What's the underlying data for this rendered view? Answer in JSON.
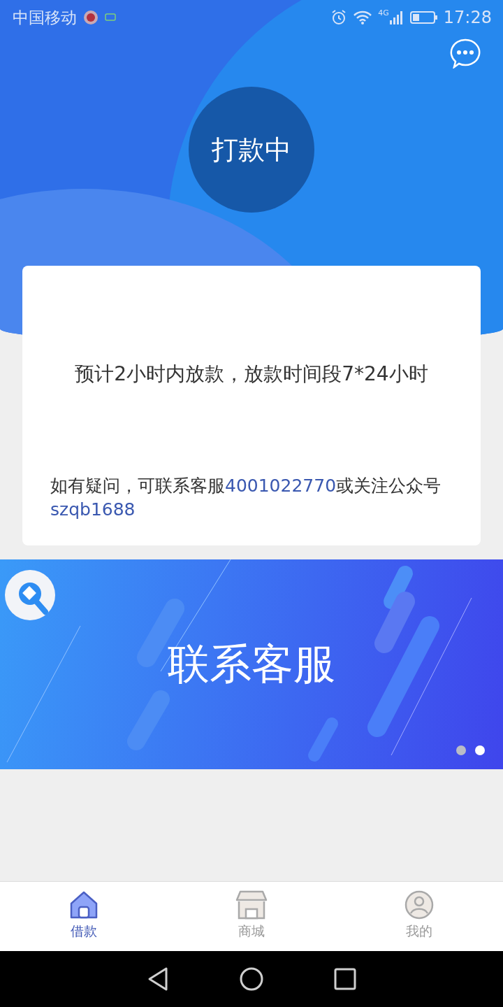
{
  "status_bar": {
    "carrier": "中国移动",
    "network": "4G",
    "time": "17:28"
  },
  "header": {
    "status": "打款中"
  },
  "card": {
    "message": "预计2小时内放款，放款时间段7*24小时",
    "help": [
      {
        "kind": "plain",
        "text": "如有疑问，可联系客服"
      },
      {
        "kind": "link",
        "text": "4001022770"
      },
      {
        "kind": "plain",
        "text": "或关注公众号"
      },
      {
        "kind": "link",
        "text": "szqb1688"
      }
    ]
  },
  "banner": {
    "title": "联系客服",
    "dots": [
      {
        "selected": false
      },
      {
        "selected": true
      }
    ]
  },
  "tabs": [
    {
      "label": "借款",
      "kind": "home",
      "selected": true
    },
    {
      "label": "商城",
      "kind": "store",
      "selected": false
    },
    {
      "label": "我的",
      "kind": "user",
      "selected": false
    }
  ]
}
